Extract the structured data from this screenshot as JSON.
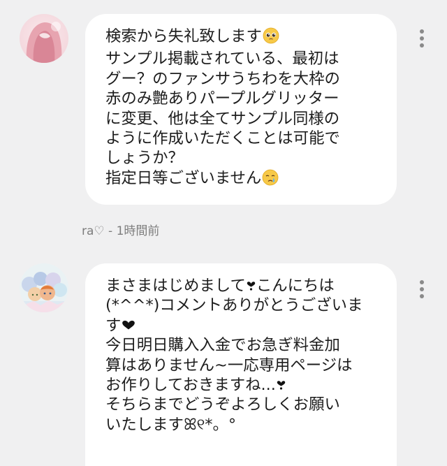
{
  "comments": [
    {
      "lines": [
        "検索から失礼致します",
        "サンプル掲載されている、最初は",
        "グー？のファンサうちわを大枠の",
        "赤のみ艶ありパープルグリッター",
        "に変更、他は全てサンプル同様の",
        "ように作成いただくことは可能で",
        "しょうか？",
        "指定日等ございません"
      ],
      "emoji": [
        "pleading-face",
        "crying-face"
      ],
      "author": "ra♡",
      "separator": " - ",
      "time": "1時間前"
    },
    {
      "lines": [
        "まさまはじめまして",
        "こんにちは",
        "(*^^*)コメントありがとうございま",
        "す",
        "今日明日購入入金でお急ぎ料金加",
        "算はありません~一応専用ページは",
        "お作りしておきますね...",
        "そちらまでどうぞよろしくお願い",
        "いたしますꕤ୧*。°"
      ]
    }
  ],
  "icons": {
    "menu": "more-vertical-icon",
    "heart": "heart-icon"
  },
  "colors": {
    "background": "#f0f0f1",
    "bubble": "#ffffff",
    "text": "#1d1d1d",
    "meta": "#7d7d7d",
    "menu_dots": "#8a8a8a"
  }
}
